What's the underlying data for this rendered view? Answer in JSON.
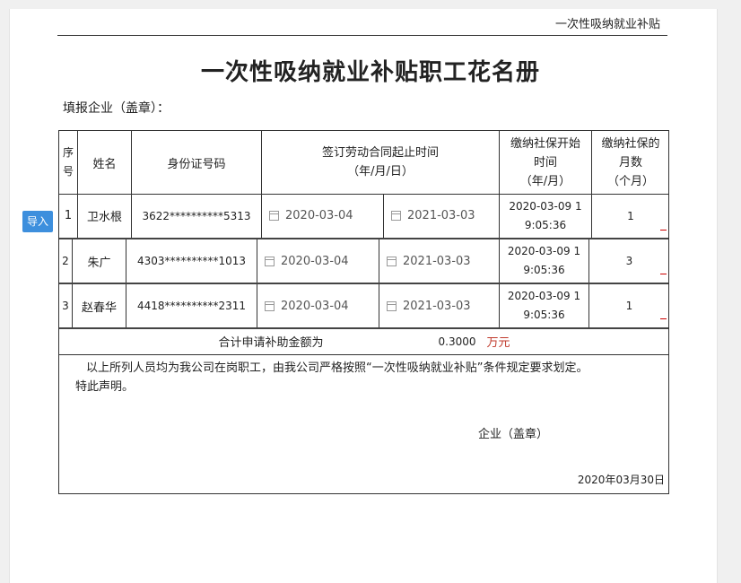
{
  "header": {
    "right_text": "一次性吸纳就业补贴"
  },
  "title": "一次性吸纳就业补贴职工花名册",
  "fill_label": "填报企业（盖章）：",
  "import_button": "导入",
  "table": {
    "headers": {
      "seq": "序号",
      "name": "姓名",
      "id": "身份证号码",
      "contract_line1": "签订劳动合同起止时间",
      "contract_line2": "（年/月/日）",
      "start_line1": "缴纳社保开始",
      "start_line2": "时间",
      "start_line3": "（年/月）",
      "months_line1": "缴纳社保的",
      "months_line2": "月数",
      "months_line3": "（个月）"
    },
    "rows": [
      {
        "seq": "1",
        "name": "卫水根",
        "id": "3622**********5313",
        "start": "2020-03-04",
        "end": "2021-03-03",
        "time_line1": "2020-03-09 1",
        "time_line2": "9:05:36",
        "months": "1"
      },
      {
        "seq": "2",
        "name": "朱广",
        "id": "4303**********1013",
        "start": "2020-03-04",
        "end": "2021-03-03",
        "time_line1": "2020-03-09 1",
        "time_line2": "9:05:36",
        "months": "3"
      },
      {
        "seq": "3",
        "name": "赵春华",
        "id": "4418**********2311",
        "start": "2020-03-04",
        "end": "2021-03-03",
        "time_line1": "2020-03-09 1",
        "time_line2": "9:05:36",
        "months": "1"
      }
    ],
    "total_label": "合计申请补助金额为",
    "total_value": "0.3000",
    "total_unit": "万元"
  },
  "statement": {
    "line1": "以上所列人员均为我公司在岗职工，由我公司严格按照“一次性吸纳就业补贴”条件规定要求划定。",
    "line2": "特此声明。",
    "seal": "企业（盖章）",
    "date": "2020年03月30日"
  },
  "colors": {
    "accent": "#3d8fdd",
    "unit_red": "#c0392b"
  }
}
